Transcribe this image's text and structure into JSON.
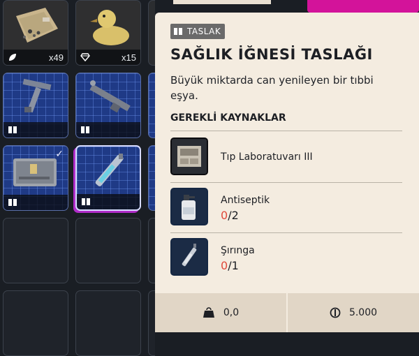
{
  "inventory": {
    "slots": [
      {
        "type": "item",
        "icon": "bag-icon",
        "count": "x49"
      },
      {
        "type": "item",
        "icon": "rubber-duck-icon",
        "count": "x15"
      },
      {
        "type": "blueprint",
        "icon": "tool-blueprint-icon"
      },
      {
        "type": "blueprint",
        "icon": "launcher-blueprint-icon"
      },
      {
        "type": "blueprint",
        "icon": "kit-blueprint-icon",
        "checked": true
      },
      {
        "type": "blueprint",
        "icon": "syringe-blueprint-icon",
        "selected": true
      }
    ]
  },
  "tooltip": {
    "tag": "TASLAK",
    "title": "SAĞLIK İĞNESİ TASLAĞI",
    "description": "Büyük miktarda can yenileyen bir tıbbi eşya.",
    "requirements_heading": "GEREKLİ KAYNAKLAR",
    "requirements": [
      {
        "name": "Tıp Laboratuvarı III",
        "icon": "lab-station-icon"
      },
      {
        "name": "Antiseptik",
        "have": "0",
        "need": "/2",
        "icon": "antiseptic-bottle-icon"
      },
      {
        "name": "Şırınga",
        "have": "0",
        "need": "/1",
        "icon": "syringe-icon"
      }
    ],
    "weight": "0,0",
    "value": "5.000"
  },
  "colors": {
    "panel_bg": "#f4ece0",
    "shortage_red": "#e04a3c",
    "blueprint_blue": "#1f3a86",
    "selection_magenta": "#b02cc9"
  }
}
